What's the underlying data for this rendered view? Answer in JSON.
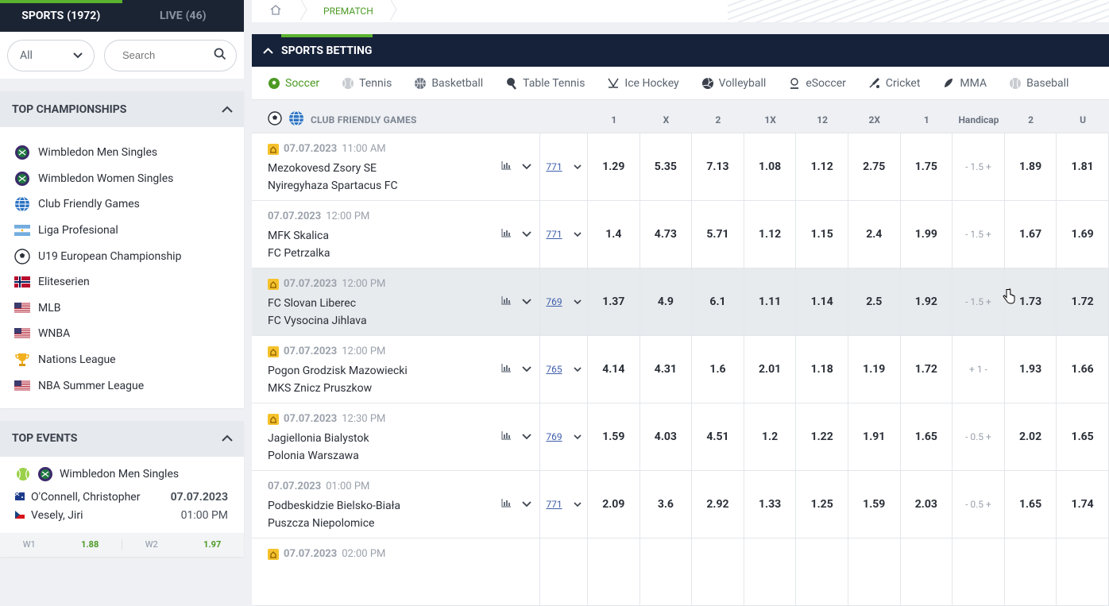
{
  "left_tabs": {
    "sports_label": "SPORTS",
    "sports_count": "(1972)",
    "live_label": "LIVE",
    "live_count": "(46)"
  },
  "filters": {
    "select_value": "All",
    "search_placeholder": "Search"
  },
  "top_championships": {
    "title": "TOP CHAMPIONSHIPS",
    "items": [
      {
        "label": "Wimbledon Men Singles",
        "icon": "tennis-ball-icon"
      },
      {
        "label": "Wimbledon Women Singles",
        "icon": "tennis-ball-icon"
      },
      {
        "label": "Club Friendly Games",
        "icon": "globe-icon"
      },
      {
        "label": "Liga Profesional",
        "icon": "argentina-flag-icon"
      },
      {
        "label": "U19 European Championship",
        "icon": "soccer-ball-icon"
      },
      {
        "label": "Eliteserien",
        "icon": "norway-flag-icon"
      },
      {
        "label": "MLB",
        "icon": "usa-flag-icon"
      },
      {
        "label": "WNBA",
        "icon": "usa-flag-icon"
      },
      {
        "label": "Nations League",
        "icon": "trophy-icon"
      },
      {
        "label": "NBA Summer League",
        "icon": "usa-flag-icon"
      }
    ]
  },
  "top_events": {
    "title": "TOP EVENTS",
    "event": {
      "league": "Wimbledon Men Singles",
      "player1": "O'Connell, Christopher",
      "player2": "Vesely, Jiri",
      "date": "07.07.2023",
      "time": "01:00 PM",
      "w1_label": "W1",
      "w1_value": "1.88",
      "w2_label": "W2",
      "w2_value": "1.97"
    }
  },
  "breadcrumb": {
    "current": "PREMATCH"
  },
  "sports_betting": {
    "title": "SPORTS BETTING"
  },
  "sports_nav": [
    "Soccer",
    "Tennis",
    "Basketball",
    "Table Tennis",
    "Ice Hockey",
    "Volleyball",
    "eSoccer",
    "Cricket",
    "MMA",
    "Baseball"
  ],
  "table": {
    "league": "CLUB FRIENDLY GAMES",
    "headers": [
      "1",
      "X",
      "2",
      "1X",
      "12",
      "2X",
      "1",
      "Handicap",
      "2",
      "U"
    ],
    "rows": [
      {
        "date": "07.07.2023",
        "time": "11:00 AM",
        "home": "Mezokovesd Zsory SE",
        "away": "Nyiregyhaza Spartacus FC",
        "markets": "771",
        "live_icon": true,
        "odds": [
          "1.29",
          "5.35",
          "7.13",
          "1.08",
          "1.12",
          "2.75",
          "1.75",
          "- 1.5 +",
          "1.89",
          "1.81"
        ]
      },
      {
        "date": "07.07.2023",
        "time": "12:00 PM",
        "home": "MFK Skalica",
        "away": "FC Petrzalka",
        "markets": "771",
        "live_icon": false,
        "odds": [
          "1.4",
          "4.73",
          "5.71",
          "1.12",
          "1.15",
          "2.4",
          "1.99",
          "- 1.5 +",
          "1.67",
          "1.69"
        ]
      },
      {
        "date": "07.07.2023",
        "time": "12:00 PM",
        "home": "FC Slovan Liberec",
        "away": "FC Vysocina Jihlava",
        "markets": "769",
        "live_icon": true,
        "odds": [
          "1.37",
          "4.9",
          "6.1",
          "1.11",
          "1.14",
          "2.5",
          "1.92",
          "- 1.5 +",
          "1.73",
          "1.72"
        ]
      },
      {
        "date": "07.07.2023",
        "time": "12:00 PM",
        "home": "Pogon Grodzisk Mazowiecki",
        "away": "MKS Znicz Pruszkow",
        "markets": "765",
        "live_icon": true,
        "odds": [
          "4.14",
          "4.31",
          "1.6",
          "2.01",
          "1.18",
          "1.19",
          "1.72",
          "+ 1 -",
          "1.93",
          "1.66"
        ]
      },
      {
        "date": "07.07.2023",
        "time": "12:30 PM",
        "home": "Jagiellonia Bialystok",
        "away": "Polonia Warszawa",
        "markets": "769",
        "live_icon": true,
        "odds": [
          "1.59",
          "4.03",
          "4.51",
          "1.2",
          "1.22",
          "1.91",
          "1.65",
          "- 0.5 +",
          "2.02",
          "1.65"
        ]
      },
      {
        "date": "07.07.2023",
        "time": "01:00 PM",
        "home": "Podbeskidzie Bielsko-Biała",
        "away": "Puszcza Niepolomice",
        "markets": "771",
        "live_icon": false,
        "odds": [
          "2.09",
          "3.6",
          "2.92",
          "1.33",
          "1.25",
          "1.59",
          "2.03",
          "- 0.5 +",
          "1.65",
          "1.74"
        ]
      },
      {
        "date": "07.07.2023",
        "time": "02:00 PM",
        "home": "",
        "away": "",
        "markets": "",
        "live_icon": true,
        "odds": [
          "",
          "",
          "",
          "",
          "",
          "",
          "",
          "",
          "",
          ""
        ]
      }
    ]
  },
  "colors": {
    "accent": "#5ab22f",
    "nav_dark": "#16213a",
    "link": "#3d5dab"
  }
}
